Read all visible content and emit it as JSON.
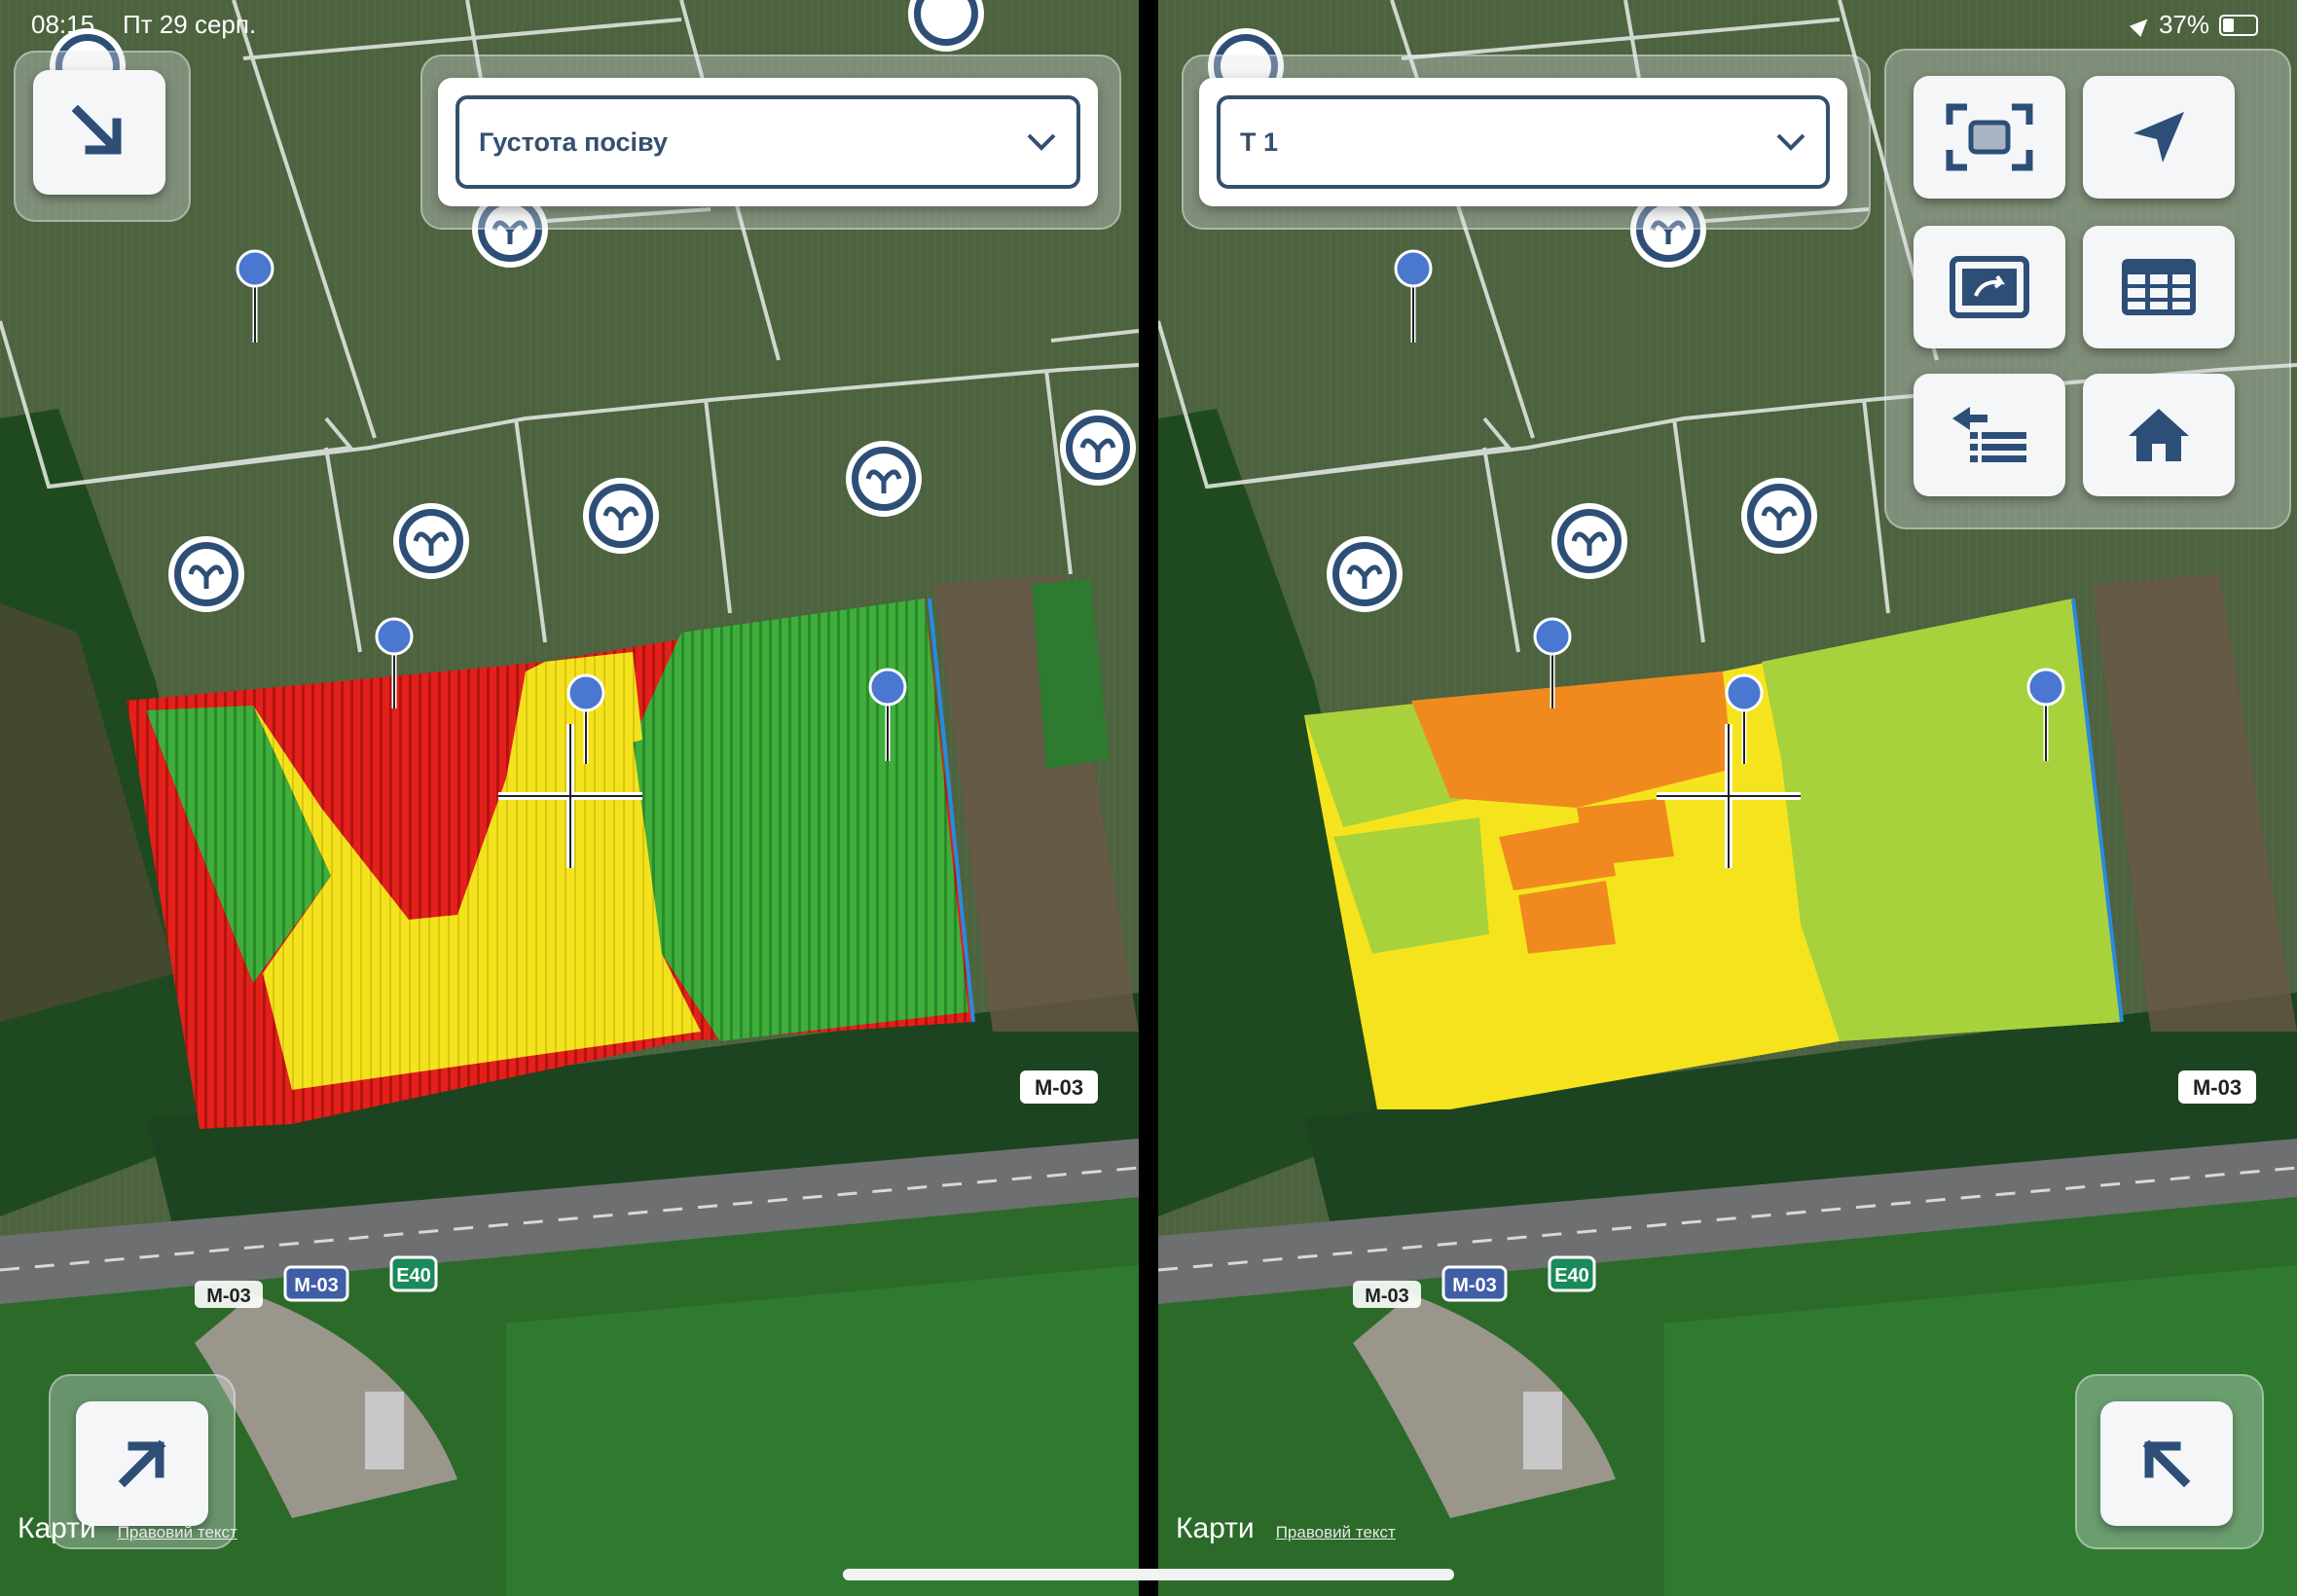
{
  "status_bar": {
    "time": "08:15",
    "date": "Пт 29 серп.",
    "battery": "37%"
  },
  "left_pane": {
    "layer_select": {
      "value": "Густота посіву"
    }
  },
  "right_pane": {
    "layer_select": {
      "value": "Т 1"
    }
  },
  "toolbar": {
    "icons": [
      "fit-extent-icon",
      "navigate-arrow-icon",
      "swap-map-icon",
      "table-icon",
      "layers-list-icon",
      "home-icon"
    ]
  },
  "road_labels": {
    "m03": "M-03",
    "e40": "E40"
  },
  "maps_credit": {
    "brand": "Карти",
    "legal": "Правовий текст"
  },
  "legend_colors": {
    "low": "#e51b17",
    "mid": "#f5e41d",
    "high": "#3aa83a",
    "orange": "#f08a1f",
    "lightgreen": "#a8d23c"
  },
  "accent_color": "#34506e"
}
